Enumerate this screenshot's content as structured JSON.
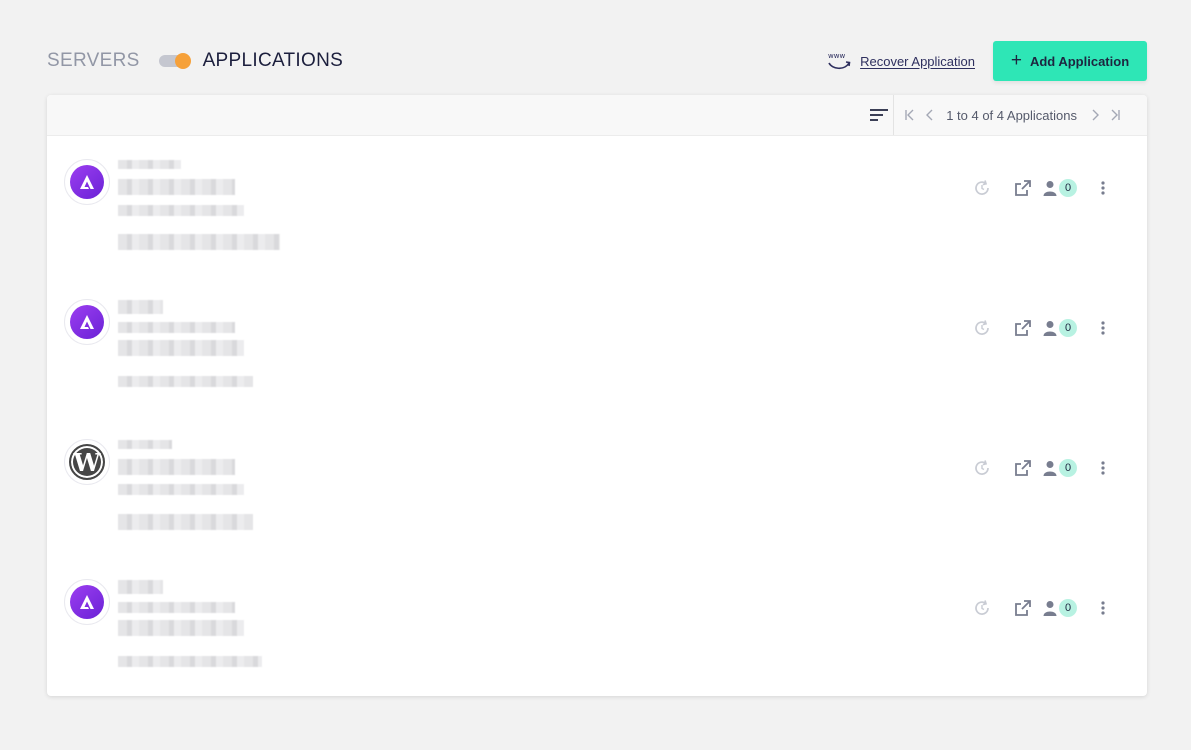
{
  "header": {
    "servers_label": "SERVERS",
    "applications_label": "APPLICATIONS",
    "recover_label": "Recover Application",
    "recover_icon_text": "www",
    "add_label": "Add Application",
    "add_icon": "plus-icon"
  },
  "toolbar": {
    "pagination_text": "1 to 4 of 4 Applications",
    "sort_icon": "sort-icon"
  },
  "applications": [
    {
      "logo": "astra-logo",
      "user_count": "0"
    },
    {
      "logo": "astra-logo",
      "user_count": "0"
    },
    {
      "logo": "wordpress-logo",
      "user_count": "0"
    },
    {
      "logo": "astra-logo",
      "user_count": "0"
    }
  ],
  "colors": {
    "accent_button": "#2ee6b6",
    "toggle_knob": "#f6a13a",
    "badge": "#b8f2e2",
    "astra_purple": "#7b2ee0"
  }
}
